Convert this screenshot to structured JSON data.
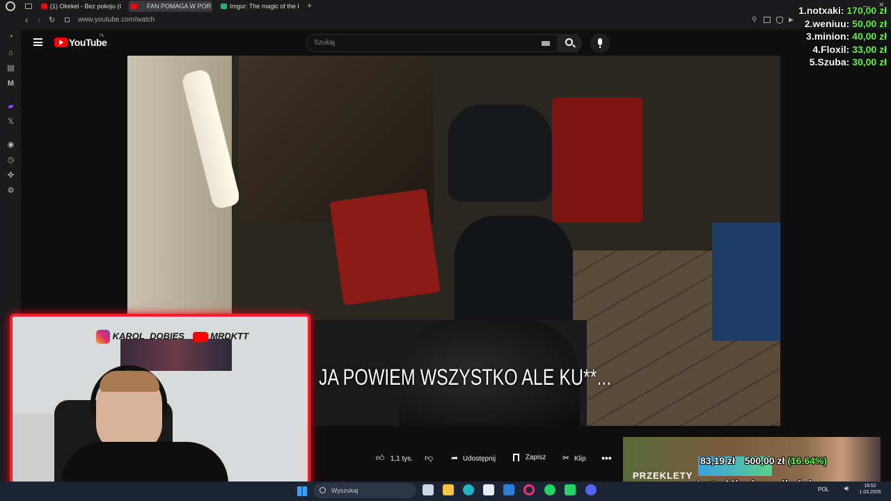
{
  "browser": {
    "tabs": [
      {
        "title": "(1) Okekel - Bez pokoju (O",
        "icon": "youtube-icon"
      },
      {
        "title": "FAN POMAGA W POR",
        "icon": "youtube-icon"
      },
      {
        "title": "Imgur: The magic of the I",
        "icon": "imgur-icon"
      }
    ],
    "url": "www.youtube.com/watch"
  },
  "youtube": {
    "logo_text": "YouTube",
    "logo_region": "PL",
    "search_placeholder": "Szukaj"
  },
  "video": {
    "subtitle": "JA POWIEM WSZYSTKO ALE KU**..."
  },
  "actions": {
    "like_count": "1,1 tys.",
    "share_label": "Udostępnij",
    "save_label": "Zapisz",
    "clip_label": "Klip"
  },
  "overlay": {
    "instagram_handle": "KAROL_DOBIES",
    "youtube_handle": "MRDKTT",
    "donations": [
      {
        "name": "1.notxaki:",
        "amount": "170,00 zł"
      },
      {
        "name": "2.weniuu:",
        "amount": "50,00 zł"
      },
      {
        "name": "3.minion:",
        "amount": "40,00 zł"
      },
      {
        "name": "4.Floxil:",
        "amount": "33,00 zł"
      },
      {
        "name": "5.Szuba:",
        "amount": "30,00 zł"
      }
    ],
    "goal_current": "83,19 zł",
    "goal_target": "500,00 zł",
    "goal_percent": "(16.64%)",
    "goal_progress": 0.1664,
    "goal_title": "Luty Miesiąc miłości",
    "goal_bg_text": "PRZEKLETY"
  },
  "taskbar": {
    "search_placeholder": "Wyszukaj",
    "time": "18:52",
    "date": "1.03.2026",
    "language": "POL"
  },
  "colors": {
    "accent_red": "#ff0000",
    "donation_green": "#5dfc3b",
    "cam_border": "#ff1a2a"
  }
}
